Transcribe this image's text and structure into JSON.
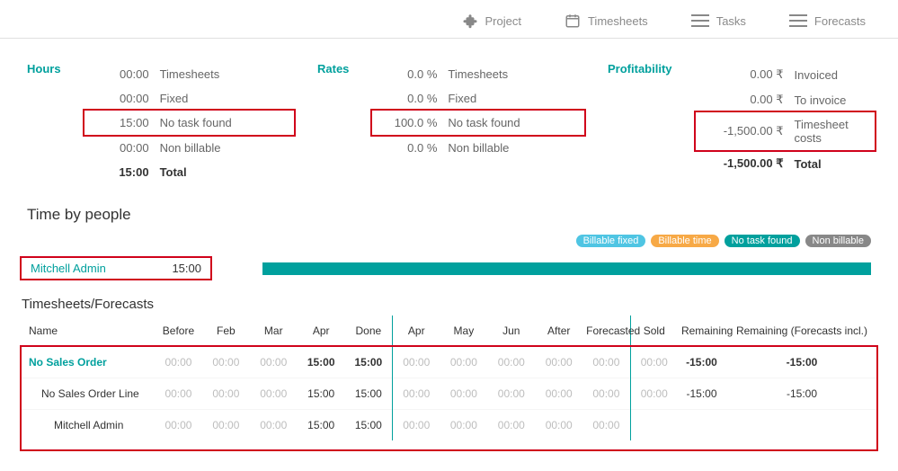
{
  "topbar": {
    "project": "Project",
    "timesheets": "Timesheets",
    "tasks": "Tasks",
    "forecasts": "Forecasts"
  },
  "hours": {
    "header": "Hours",
    "items": [
      {
        "val": "00:00",
        "lbl": "Timesheets"
      },
      {
        "val": "00:00",
        "lbl": "Fixed"
      },
      {
        "val": "15:00",
        "lbl": "No task found"
      },
      {
        "val": "00:00",
        "lbl": "Non billable"
      }
    ],
    "total": {
      "val": "15:00",
      "lbl": "Total"
    }
  },
  "rates": {
    "header": "Rates",
    "items": [
      {
        "val": "0.0 %",
        "lbl": "Timesheets"
      },
      {
        "val": "0.0 %",
        "lbl": "Fixed"
      },
      {
        "val": "100.0 %",
        "lbl": "No task found"
      },
      {
        "val": "0.0 %",
        "lbl": "Non billable"
      }
    ]
  },
  "prof": {
    "header": "Profitability",
    "items": [
      {
        "val": "0.00 ₹",
        "lbl": "Invoiced"
      },
      {
        "val": "0.00 ₹",
        "lbl": "To invoice"
      },
      {
        "val": "-1,500.00 ₹",
        "lbl": "Timesheet costs"
      }
    ],
    "total": {
      "val": "-1,500.00 ₹",
      "lbl": "Total"
    }
  },
  "tbp": {
    "title": "Time by people",
    "legend": {
      "bf": "Billable fixed",
      "bt": "Billable time",
      "nt": "No task found",
      "nb": "Non billable"
    },
    "person": {
      "name": "Mitchell Admin",
      "hours": "15:00"
    }
  },
  "table": {
    "title": "Timesheets/Forecasts",
    "cols": {
      "name": "Name",
      "before": "Before",
      "feb": "Feb",
      "mar": "Mar",
      "apr": "Apr",
      "done": "Done",
      "apr2": "Apr",
      "may": "May",
      "jun": "Jun",
      "after": "After",
      "forecasted": "Forecasted",
      "sold": "Sold",
      "remaining": "Remaining",
      "remaining_fc": "Remaining (Forecasts incl.)"
    },
    "rows": [
      {
        "kind": "group",
        "name": "No Sales Order",
        "cells": [
          "00:00",
          "00:00",
          "00:00",
          "15:00",
          "15:00",
          "00:00",
          "00:00",
          "00:00",
          "00:00",
          "00:00",
          "00:00",
          "-15:00",
          "-15:00"
        ]
      },
      {
        "kind": "sub1",
        "name": "No Sales Order Line",
        "cells": [
          "00:00",
          "00:00",
          "00:00",
          "15:00",
          "15:00",
          "00:00",
          "00:00",
          "00:00",
          "00:00",
          "00:00",
          "00:00",
          "-15:00",
          "-15:00"
        ]
      },
      {
        "kind": "sub2",
        "name": "Mitchell Admin",
        "cells": [
          "00:00",
          "00:00",
          "00:00",
          "15:00",
          "15:00",
          "00:00",
          "00:00",
          "00:00",
          "00:00",
          "00:00",
          "",
          "",
          ""
        ]
      }
    ]
  }
}
